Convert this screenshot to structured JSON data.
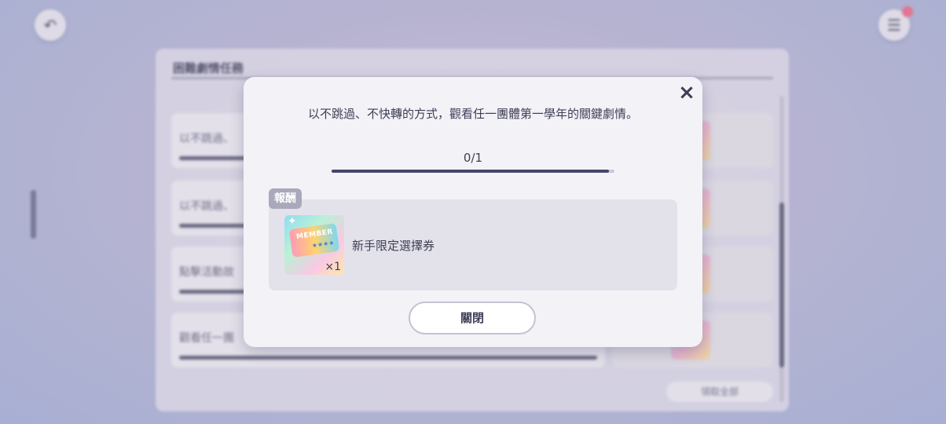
{
  "background": {
    "panel_title": "困難劇情任務",
    "rows": [
      {
        "text": "以不跳過、"
      },
      {
        "text": "以不跳過、"
      },
      {
        "text": "點擊活動故"
      },
      {
        "text": "觀看任一團"
      }
    ],
    "claim_all_label": "領取全部"
  },
  "modal": {
    "description": "以不跳過、不快轉的方式，觀看任一團體第一學年的關鍵劇情。",
    "progress_text": "0/1",
    "progress_fraction": 0.98,
    "reward_tag": "報酬",
    "reward": {
      "icon": "member-ticket-icon",
      "ticket_text": "MEMBER",
      "ticket_stars": "★★★★",
      "quantity": "×1",
      "name": "新手限定選擇券"
    },
    "close_button": "關閉",
    "close_icon": "×"
  },
  "colors": {
    "accent": "#45466a",
    "reward_tag": "#a9a9bc",
    "notification": "#ef6b8a"
  }
}
